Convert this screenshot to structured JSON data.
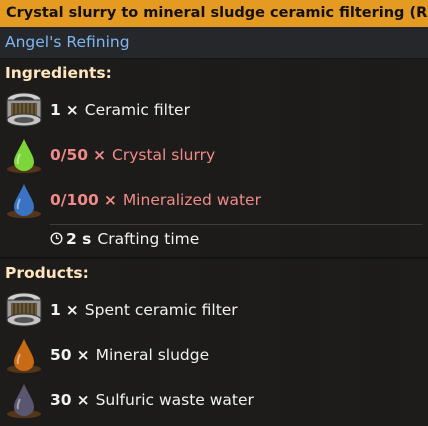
{
  "title": "Crystal slurry to mineral sludge ceramic filtering (Recipe)",
  "mod": "Angel's Refining",
  "ingredients": {
    "heading": "Ingredients:",
    "items": [
      {
        "qty": "1",
        "times": "×",
        "name": "Ceramic filter",
        "icon": "ceramic-filter-icon",
        "missing": false
      },
      {
        "qty": "0/50",
        "times": "×",
        "name": "Crystal slurry",
        "icon": "crystal-slurry-icon",
        "missing": true
      },
      {
        "qty": "0/100",
        "times": "×",
        "name": "Mineralized water",
        "icon": "mineralized-water-icon",
        "missing": true
      }
    ],
    "crafting": {
      "time": "2 s",
      "label": "Crafting time"
    }
  },
  "products": {
    "heading": "Products:",
    "items": [
      {
        "qty": "1",
        "times": "×",
        "name": "Spent ceramic filter",
        "icon": "spent-ceramic-filter-icon"
      },
      {
        "qty": "50",
        "times": "×",
        "name": "Mineral sludge",
        "icon": "mineral-sludge-icon"
      },
      {
        "qty": "30",
        "times": "×",
        "name": "Sulfuric waste water",
        "icon": "sulfuric-waste-water-icon"
      }
    ]
  },
  "colors": {
    "title_bg": "#e59a21",
    "mod_text": "#7fb7f0",
    "section_heading": "#ffe6c0",
    "missing_text": "#f08a8a",
    "crystal_slurry": "#7cd63a",
    "mineralized_water": "#3a73c4",
    "mineral_sludge": "#c96a14",
    "sulfuric_waste_water": "#5a5670"
  }
}
